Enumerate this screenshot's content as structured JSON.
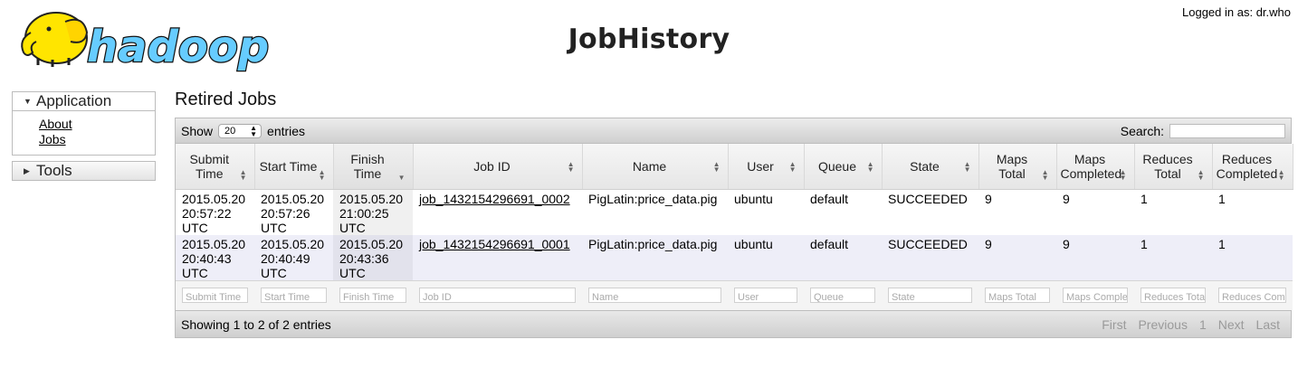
{
  "header": {
    "logo_text": "hadoop",
    "title": "JobHistory",
    "logged_in": "Logged in as: dr.who"
  },
  "nav": {
    "application_label": "Application",
    "items": [
      {
        "label": "About"
      },
      {
        "label": "Jobs"
      }
    ],
    "tools_label": "Tools"
  },
  "main": {
    "section_title": "Retired Jobs",
    "show_label": "Show",
    "entries_value": "20",
    "entries_label": "entries",
    "search_label": "Search:",
    "columns": [
      {
        "label": "Submit Time"
      },
      {
        "label": "Start Time"
      },
      {
        "label": "Finish Time"
      },
      {
        "label": "Job ID"
      },
      {
        "label": "Name"
      },
      {
        "label": "User"
      },
      {
        "label": "Queue"
      },
      {
        "label": "State"
      },
      {
        "label": "Maps Total"
      },
      {
        "label": "Maps Completed"
      },
      {
        "label": "Reduces Total"
      },
      {
        "label": "Reduces Completed"
      }
    ],
    "rows": [
      {
        "submit": "2015.05.20 20:57:22 UTC",
        "start": "2015.05.20 20:57:26 UTC",
        "finish": "2015.05.20 21:00:25 UTC",
        "job_id": "job_1432154296691_0002",
        "name": "PigLatin:price_data.pig",
        "user": "ubuntu",
        "queue": "default",
        "state": "SUCCEEDED",
        "maps_total": "9",
        "maps_completed": "9",
        "reduces_total": "1",
        "reduces_completed": "1"
      },
      {
        "submit": "2015.05.20 20:40:43 UTC",
        "start": "2015.05.20 20:40:49 UTC",
        "finish": "2015.05.20 20:43:36 UTC",
        "job_id": "job_1432154296691_0001",
        "name": "PigLatin:price_data.pig",
        "user": "ubuntu",
        "queue": "default",
        "state": "SUCCEEDED",
        "maps_total": "9",
        "maps_completed": "9",
        "reduces_total": "1",
        "reduces_completed": "1"
      }
    ],
    "filters": [
      "Submit Time",
      "Start Time",
      "Finish Time",
      "Job ID",
      "Name",
      "User",
      "Queue",
      "State",
      "Maps Total",
      "Maps Comple",
      "Reduces Tota",
      "Reduces Com"
    ],
    "footer_info": "Showing 1 to 2 of 2 entries",
    "pager": {
      "first": "First",
      "previous": "Previous",
      "page": "1",
      "next": "Next",
      "last": "Last"
    }
  },
  "colors": {
    "elephant": "#ffe500",
    "logo_blue": "#66ccff",
    "row_alt": "#eeeef8"
  }
}
